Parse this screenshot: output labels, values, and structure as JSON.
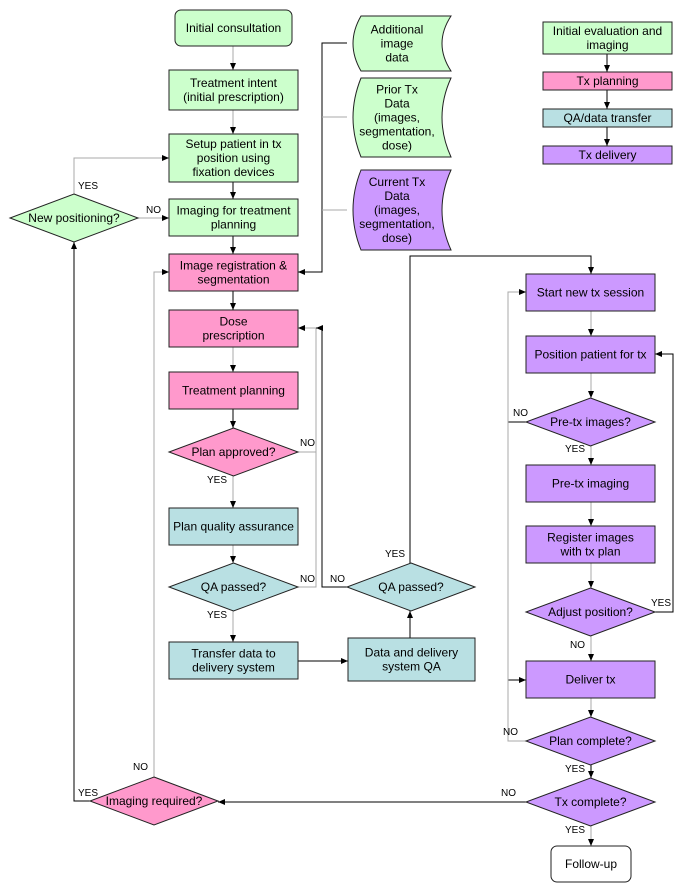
{
  "colors": {
    "evaluation": "#ccffcc",
    "planning": "#ff99cc",
    "qa_transfer": "#b9e0e3",
    "delivery": "#cc99ff",
    "terminal_end": "#ffffff",
    "edge_dark": "#000000",
    "edge_gray": "#a8a8a8"
  },
  "legend": [
    {
      "id": "leg-eval",
      "label": "Initial evaluation and imaging",
      "phase": "evaluation"
    },
    {
      "id": "leg-plan",
      "label": "Tx planning",
      "phase": "planning"
    },
    {
      "id": "leg-qa",
      "label": "QA/data transfer",
      "phase": "qa_transfer"
    },
    {
      "id": "leg-del",
      "label": "Tx delivery",
      "phase": "delivery"
    }
  ],
  "nodes": [
    {
      "id": "initial-consultation",
      "type": "terminal",
      "phase": "evaluation",
      "lines": [
        "Initial consultation"
      ]
    },
    {
      "id": "treatment-intent",
      "type": "process",
      "phase": "evaluation",
      "lines": [
        "Treatment intent",
        "(initial prescription)"
      ]
    },
    {
      "id": "setup-patient",
      "type": "process",
      "phase": "evaluation",
      "lines": [
        "Setup patient in tx",
        "position using",
        "fixation devices"
      ]
    },
    {
      "id": "imaging-for-planning",
      "type": "process",
      "phase": "evaluation",
      "lines": [
        "Imaging for treatment",
        "planning"
      ]
    },
    {
      "id": "new-positioning",
      "type": "decision",
      "phase": "evaluation",
      "lines": [
        "New positioning?"
      ]
    },
    {
      "id": "additional-image-data",
      "type": "data",
      "phase": "evaluation",
      "lines": [
        "Additional",
        "image",
        "data"
      ]
    },
    {
      "id": "prior-tx-data",
      "type": "data",
      "phase": "evaluation",
      "lines": [
        "Prior Tx",
        "Data",
        "(images,",
        "segmentation,",
        "dose)"
      ]
    },
    {
      "id": "current-tx-data",
      "type": "data",
      "phase": "delivery",
      "lines": [
        "Current Tx",
        "Data",
        "(images,",
        "segmentation,",
        "dose)"
      ]
    },
    {
      "id": "image-registration",
      "type": "process",
      "phase": "planning",
      "lines": [
        "Image registration &",
        "segmentation"
      ]
    },
    {
      "id": "dose-prescription",
      "type": "process",
      "phase": "planning",
      "lines": [
        "Dose",
        "prescription"
      ]
    },
    {
      "id": "treatment-planning",
      "type": "process",
      "phase": "planning",
      "lines": [
        "Treatment planning"
      ]
    },
    {
      "id": "plan-approved",
      "type": "decision",
      "phase": "planning",
      "lines": [
        "Plan approved?"
      ]
    },
    {
      "id": "plan-qa",
      "type": "process",
      "phase": "qa_transfer",
      "lines": [
        "Plan quality assurance"
      ]
    },
    {
      "id": "qa-passed-1",
      "type": "decision",
      "phase": "qa_transfer",
      "lines": [
        "QA passed?"
      ]
    },
    {
      "id": "transfer-data",
      "type": "process",
      "phase": "qa_transfer",
      "lines": [
        "Transfer data to",
        "delivery system"
      ]
    },
    {
      "id": "delivery-system-qa",
      "type": "process",
      "phase": "qa_transfer",
      "lines": [
        "Data and delivery",
        "system QA"
      ]
    },
    {
      "id": "qa-passed-2",
      "type": "decision",
      "phase": "qa_transfer",
      "lines": [
        "QA passed?"
      ]
    },
    {
      "id": "imaging-required",
      "type": "decision",
      "phase": "planning",
      "lines": [
        "Imaging required?"
      ]
    },
    {
      "id": "start-session",
      "type": "process",
      "phase": "delivery",
      "lines": [
        "Start new tx session"
      ]
    },
    {
      "id": "position-patient",
      "type": "process",
      "phase": "delivery",
      "lines": [
        "Position patient for tx"
      ]
    },
    {
      "id": "pre-tx-images",
      "type": "decision",
      "phase": "delivery",
      "lines": [
        "Pre-tx images?"
      ]
    },
    {
      "id": "pre-tx-imaging",
      "type": "process",
      "phase": "delivery",
      "lines": [
        "Pre-tx imaging"
      ]
    },
    {
      "id": "register-images",
      "type": "process",
      "phase": "delivery",
      "lines": [
        "Register images",
        "with tx plan"
      ]
    },
    {
      "id": "adjust-position",
      "type": "decision",
      "phase": "delivery",
      "lines": [
        "Adjust position?"
      ]
    },
    {
      "id": "deliver-tx",
      "type": "process",
      "phase": "delivery",
      "lines": [
        "Deliver tx"
      ]
    },
    {
      "id": "plan-complete",
      "type": "decision",
      "phase": "delivery",
      "lines": [
        "Plan complete?"
      ]
    },
    {
      "id": "tx-complete",
      "type": "decision",
      "phase": "delivery",
      "lines": [
        "Tx complete?"
      ]
    },
    {
      "id": "follow-up",
      "type": "terminal",
      "phase": "terminal_end",
      "lines": [
        "Follow-up"
      ]
    }
  ],
  "edges": [
    {
      "id": "e1",
      "from": "initial-consultation",
      "to": "treatment-intent",
      "label": "",
      "color": "gray"
    },
    {
      "id": "e2",
      "from": "treatment-intent",
      "to": "setup-patient",
      "label": "",
      "color": "gray"
    },
    {
      "id": "e3",
      "from": "setup-patient",
      "to": "imaging-for-planning",
      "label": "",
      "color": "dark"
    },
    {
      "id": "e4",
      "from": "new-positioning",
      "to": "setup-patient",
      "label": "YES",
      "color": "gray"
    },
    {
      "id": "e5",
      "from": "new-positioning",
      "to": "imaging-for-planning",
      "label": "NO",
      "color": "gray"
    },
    {
      "id": "e6",
      "from": "imaging-for-planning",
      "to": "image-registration",
      "label": "",
      "color": "dark"
    },
    {
      "id": "e7",
      "from": "data-stores",
      "to": "image-registration",
      "label": "",
      "color": "dark"
    },
    {
      "id": "e8",
      "from": "image-registration",
      "to": "dose-prescription",
      "label": "",
      "color": "dark"
    },
    {
      "id": "e9",
      "from": "dose-prescription",
      "to": "treatment-planning",
      "label": "",
      "color": "gray"
    },
    {
      "id": "e10",
      "from": "treatment-planning",
      "to": "plan-approved",
      "label": "",
      "color": "dark"
    },
    {
      "id": "e11",
      "from": "plan-approved",
      "to": "dose-prescription",
      "label": "NO",
      "color": "gray"
    },
    {
      "id": "e12",
      "from": "plan-approved",
      "to": "plan-qa",
      "label": "YES",
      "color": "gray"
    },
    {
      "id": "e13",
      "from": "plan-qa",
      "to": "qa-passed-1",
      "label": "",
      "color": "gray"
    },
    {
      "id": "e14",
      "from": "qa-passed-1",
      "to": "dose-prescription",
      "label": "NO",
      "color": "gray"
    },
    {
      "id": "e15",
      "from": "qa-passed-1",
      "to": "transfer-data",
      "label": "YES",
      "color": "gray"
    },
    {
      "id": "e16",
      "from": "transfer-data",
      "to": "delivery-system-qa",
      "label": "",
      "color": "dark"
    },
    {
      "id": "e17",
      "from": "delivery-system-qa",
      "to": "qa-passed-2",
      "label": "",
      "color": "dark"
    },
    {
      "id": "e18",
      "from": "qa-passed-2",
      "to": "dose-prescription",
      "label": "NO",
      "color": "dark"
    },
    {
      "id": "e19",
      "from": "qa-passed-2",
      "to": "start-session",
      "label": "YES",
      "color": "dark"
    },
    {
      "id": "e20",
      "from": "start-session",
      "to": "position-patient",
      "label": "",
      "color": "gray"
    },
    {
      "id": "e21",
      "from": "position-patient",
      "to": "pre-tx-images",
      "label": "",
      "color": "gray"
    },
    {
      "id": "e22",
      "from": "pre-tx-images",
      "to": "pre-tx-imaging",
      "label": "YES",
      "color": "gray"
    },
    {
      "id": "e23",
      "from": "pre-tx-images",
      "to": "deliver-tx",
      "label": "NO",
      "color": "dark"
    },
    {
      "id": "e24",
      "from": "pre-tx-imaging",
      "to": "register-images",
      "label": "",
      "color": "gray"
    },
    {
      "id": "e25",
      "from": "register-images",
      "to": "adjust-position",
      "label": "",
      "color": "gray"
    },
    {
      "id": "e26",
      "from": "adjust-position",
      "to": "position-patient",
      "label": "YES",
      "color": "dark"
    },
    {
      "id": "e27",
      "from": "adjust-position",
      "to": "deliver-tx",
      "label": "NO",
      "color": "gray"
    },
    {
      "id": "e28",
      "from": "deliver-tx",
      "to": "plan-complete",
      "label": "",
      "color": "gray"
    },
    {
      "id": "e29",
      "from": "plan-complete",
      "to": "start-session",
      "label": "NO",
      "color": "gray"
    },
    {
      "id": "e30",
      "from": "plan-complete",
      "to": "tx-complete",
      "label": "YES",
      "color": "dark"
    },
    {
      "id": "e31",
      "from": "tx-complete",
      "to": "imaging-required",
      "label": "NO",
      "color": "dark"
    },
    {
      "id": "e32",
      "from": "tx-complete",
      "to": "follow-up",
      "label": "YES",
      "color": "gray"
    },
    {
      "id": "e33",
      "from": "imaging-required",
      "to": "new-positioning",
      "label": "YES",
      "color": "dark"
    },
    {
      "id": "e34",
      "from": "imaging-required",
      "to": "image-registration",
      "label": "NO",
      "color": "gray"
    },
    {
      "id": "e35",
      "from": "leg-eval",
      "to": "leg-plan",
      "label": "",
      "color": "dark"
    },
    {
      "id": "e36",
      "from": "leg-plan",
      "to": "leg-qa",
      "label": "",
      "color": "dark"
    },
    {
      "id": "e37",
      "from": "leg-qa",
      "to": "leg-del",
      "label": "",
      "color": "dark"
    }
  ]
}
